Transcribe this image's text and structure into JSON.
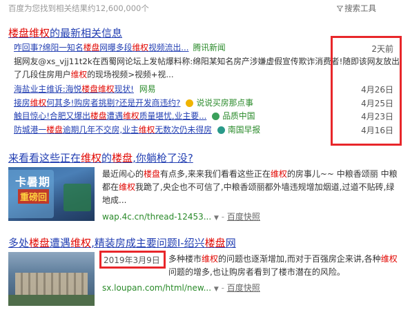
{
  "header": {
    "result_count": "百度为您找到相关结果约12,600,000个",
    "search_tools": "搜索工具"
  },
  "news_block": {
    "title_parts": [
      {
        "t": "楼盘",
        "hl": true
      },
      {
        "t": "维权",
        "hl": true
      },
      {
        "t": "的最新相关信息",
        "hl": false
      }
    ],
    "first_item": {
      "title_parts": [
        {
          "t": "咋回事?绵阳一知名",
          "hl": false
        },
        {
          "t": "楼盘",
          "hl": true
        },
        {
          "t": "网曝多段",
          "hl": false
        },
        {
          "t": "维权",
          "hl": true
        },
        {
          "t": "视频流出...",
          "hl": false
        }
      ],
      "source": "腾讯新闻",
      "date": "2天前",
      "abstract_parts": [
        {
          "t": "据网友@xs_vjj11t2k在西蜀网论坛上发帖爆料称:绵阳某知名房产涉嫌虚假宣传欺诈消费者!随即该网友放出了几段住房用户",
          "hl": false
        },
        {
          "t": "维权",
          "hl": true
        },
        {
          "t": "的现场视频>视频+视...",
          "hl": false
        }
      ]
    },
    "items": [
      {
        "title_parts": [
          {
            "t": "海盐业主维诉:海悦",
            "hl": false
          },
          {
            "t": "楼盘维权",
            "hl": true
          },
          {
            "t": "现状!",
            "hl": false
          }
        ],
        "source": "网易",
        "date": "4月26日"
      },
      {
        "title_parts": [
          {
            "t": "接房",
            "hl": false
          },
          {
            "t": "维权",
            "hl": true
          },
          {
            "t": "何其多!购房者挑剔?还是开发商违约?",
            "hl": false
          }
        ],
        "source": "说说买房那点事",
        "date": "4月25日"
      },
      {
        "title_parts": [
          {
            "t": "触目惊心!合肥又爆出",
            "hl": false
          },
          {
            "t": "楼盘",
            "hl": true
          },
          {
            "t": "遭遇",
            "hl": false
          },
          {
            "t": "维权",
            "hl": true
          },
          {
            "t": "质量堪忧,业主要...",
            "hl": false
          }
        ],
        "source": "品质中国",
        "date": "4月23日"
      },
      {
        "title_parts": [
          {
            "t": "防城港一",
            "hl": false
          },
          {
            "t": "楼盘",
            "hl": true
          },
          {
            "t": "逾期几年不交房,业主",
            "hl": false
          },
          {
            "t": "维权",
            "hl": true
          },
          {
            "t": "无数次仍未得房",
            "hl": false
          }
        ],
        "source": "南国早报",
        "date": "4月16日"
      }
    ]
  },
  "result1": {
    "title_parts": [
      {
        "t": "来看看这些正在",
        "hl": false
      },
      {
        "t": "维权",
        "hl": true
      },
      {
        "t": "的",
        "hl": false
      },
      {
        "t": "楼盘",
        "hl": true
      },
      {
        "t": ",你躺枪了没?",
        "hl": false
      }
    ],
    "snippet_parts": [
      {
        "t": "最近闹心的",
        "hl": false
      },
      {
        "t": "楼盘",
        "hl": true
      },
      {
        "t": "有点多,来来我们看看这些正在",
        "hl": false
      },
      {
        "t": "维权",
        "hl": true
      },
      {
        "t": "的房事儿~~ 中粮香颂丽 中粮都在",
        "hl": false
      },
      {
        "t": "维权",
        "hl": true
      },
      {
        "t": "我跪了,央企也不可信了,中粮香颂丽都外墙违规增加烟道,过道不贴砖,绿地成...",
        "hl": false
      }
    ],
    "url": "wap.4c.cn/thread-12453...",
    "snapshot": "百度快照",
    "thumb_text_1": "卡暑期",
    "thumb_text_2": "重磅回"
  },
  "result2": {
    "title_parts": [
      {
        "t": "多处",
        "hl": false
      },
      {
        "t": "楼盘",
        "hl": true
      },
      {
        "t": "遭遇",
        "hl": false
      },
      {
        "t": "维权",
        "hl": true
      },
      {
        "t": ",精装房成主要问题I-绍兴",
        "hl": false
      },
      {
        "t": "楼盘",
        "hl": true
      },
      {
        "t": "网",
        "hl": false
      }
    ],
    "date": "2019年3月9日",
    "snippet_parts": [
      {
        "t": "多种",
        "hl": false
      },
      {
        "t": "楼市",
        "hl": false
      },
      {
        "t": "维权",
        "hl": true
      },
      {
        "t": "的问题也逐渐增加,而对于百强房企来讲,各种",
        "hl": false
      },
      {
        "t": "维权",
        "hl": true
      },
      {
        "t": "问题的增多,也让购房者看到了楼市潜在的风险。",
        "hl": false
      }
    ],
    "url": "sx.loupan.com/html/new...",
    "snapshot": "百度快照"
  },
  "colors": {
    "link": "#2440b3",
    "highlight": "#e10601",
    "source_green": "#2a8a2a",
    "annotation_red": "#e8262a"
  }
}
